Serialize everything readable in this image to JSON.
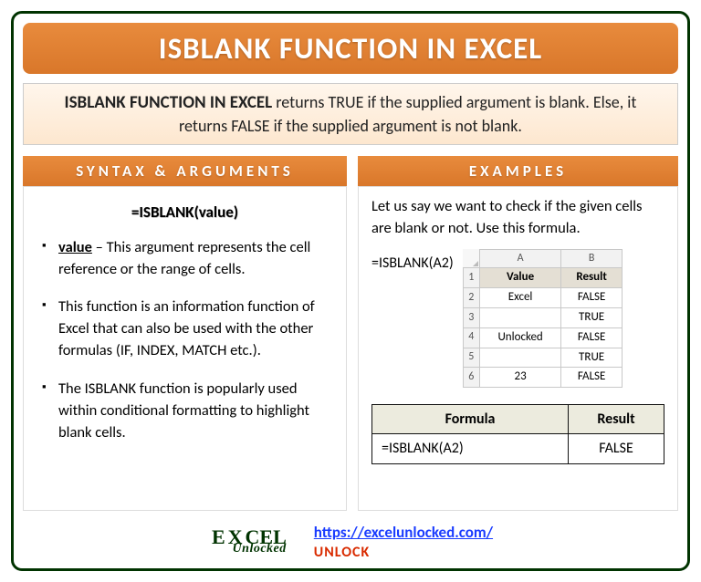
{
  "title": "ISBLANK FUNCTION IN EXCEL",
  "description": {
    "lead": "ISBLANK FUNCTION IN EXCEL",
    "rest": " returns TRUE if the supplied argument is blank. Else, it returns FALSE if the supplied argument is not blank."
  },
  "left": {
    "heading": "SYNTAX & ARGUMENTS",
    "syntax": "=ISBLANK(value)",
    "arg_name": "value",
    "arg_desc": " – This argument represents the cell reference or the range of cells.",
    "note1": "This function is an information function of Excel that can also be used with the other formulas (IF, INDEX, MATCH etc.).",
    "note2": "The ISBLANK function is popularly used within conditional formatting to highlight blank cells."
  },
  "right": {
    "heading": "EXAMPLES",
    "intro": "Let us say we want to check if the given cells are blank or not. Use this formula.",
    "formula": "=ISBLANK(A2)",
    "sheet": {
      "colA": "A",
      "colB": "B",
      "head_value": "Value",
      "head_result": "Result",
      "rows": [
        {
          "n": "1"
        },
        {
          "n": "2",
          "a": "Excel",
          "b": "FALSE"
        },
        {
          "n": "3",
          "a": "",
          "b": "TRUE"
        },
        {
          "n": "4",
          "a": "Unlocked",
          "b": "FALSE"
        },
        {
          "n": "5",
          "a": "",
          "b": "TRUE"
        },
        {
          "n": "6",
          "a": "23",
          "b": "FALSE"
        }
      ]
    },
    "result_table": {
      "h1": "Formula",
      "h2": "Result",
      "c1": "=ISBLANK(A2)",
      "c2": "FALSE"
    }
  },
  "footer": {
    "logo_top": "E CEL",
    "logo_sub": "Unlocked",
    "url": "https://excelunlocked.com/",
    "unlock": "UNLOCK"
  },
  "chart_data": {
    "type": "table",
    "title": "ISBLANK example sheet",
    "columns": [
      "Value",
      "Result"
    ],
    "rows": [
      [
        "Excel",
        "FALSE"
      ],
      [
        "",
        "TRUE"
      ],
      [
        "Unlocked",
        "FALSE"
      ],
      [
        "",
        "TRUE"
      ],
      [
        23,
        "FALSE"
      ]
    ]
  }
}
